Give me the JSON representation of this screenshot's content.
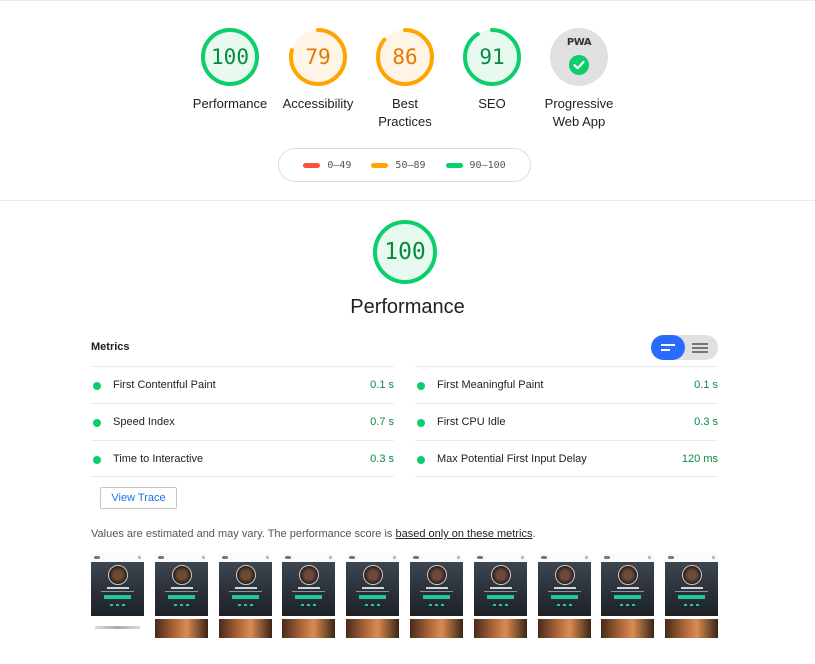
{
  "categories": [
    {
      "key": "performance",
      "score": "100",
      "label": "Performance",
      "color": "#0cce6b",
      "bg": "#e8faf0",
      "fraction": 1.0
    },
    {
      "key": "accessibility",
      "score": "79",
      "label": "Accessibility",
      "color": "#ffa400",
      "bg": "#fff5e6",
      "fraction": 0.79
    },
    {
      "key": "best-practices",
      "score": "86",
      "label": "Best Practices",
      "color": "#ffa400",
      "bg": "#fff5e6",
      "fraction": 0.86
    },
    {
      "key": "seo",
      "score": "91",
      "label": "SEO",
      "color": "#0cce6b",
      "bg": "#e8faf0",
      "fraction": 0.91
    }
  ],
  "pwa": {
    "badge": "PWA",
    "label": "Progressive Web App"
  },
  "legend": [
    {
      "range": "0–49",
      "color": "#ff4e42"
    },
    {
      "range": "50–89",
      "color": "#ffa400"
    },
    {
      "range": "90–100",
      "color": "#0cce6b"
    }
  ],
  "performance": {
    "score": "100",
    "title": "Performance",
    "fraction": 1.0,
    "color": "#0cce6b"
  },
  "metrics": {
    "title": "Metrics",
    "left": [
      {
        "name": "First Contentful Paint",
        "value": "0.1 s"
      },
      {
        "name": "Speed Index",
        "value": "0.7 s"
      },
      {
        "name": "Time to Interactive",
        "value": "0.3 s"
      }
    ],
    "right": [
      {
        "name": "First Meaningful Paint",
        "value": "0.1 s"
      },
      {
        "name": "First CPU Idle",
        "value": "0.3 s"
      },
      {
        "name": "Max Potential First Input Delay",
        "value": "120 ms"
      }
    ]
  },
  "view_trace": "View Trace",
  "note": {
    "text": "Values are estimated and may vary. The performance score is ",
    "link": "based only on these metrics",
    "end": "."
  },
  "filmstrip_frames": 10
}
